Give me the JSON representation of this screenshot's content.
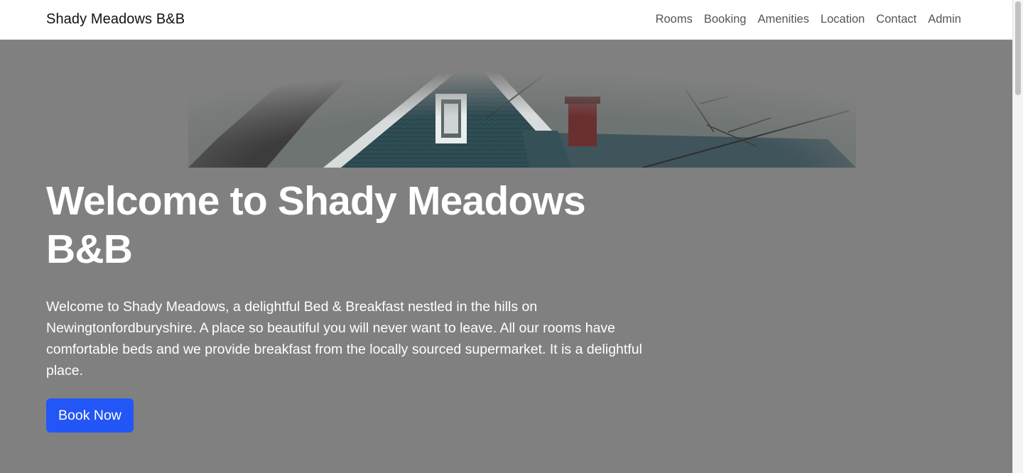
{
  "navbar": {
    "brand": "Shady Meadows B&B",
    "links": [
      "Rooms",
      "Booking",
      "Amenities",
      "Location",
      "Contact",
      "Admin"
    ]
  },
  "hero": {
    "title": "Welcome to Shady Meadows B&B",
    "description": "Welcome to Shady Meadows, a delightful Bed & Breakfast nestled in the hills on Newingtonfordburyshire. A place so beautiful you will never want to leave. All our rooms have comfortable beds and we provide breakfast from the locally sourced supermarket. It is a delightful place.",
    "cta_label": "Book Now",
    "image_alt": "house-roof-image"
  },
  "colors": {
    "hero_background": "#808080",
    "cta": "#2356f7",
    "navbar_background": "#ffffff"
  }
}
